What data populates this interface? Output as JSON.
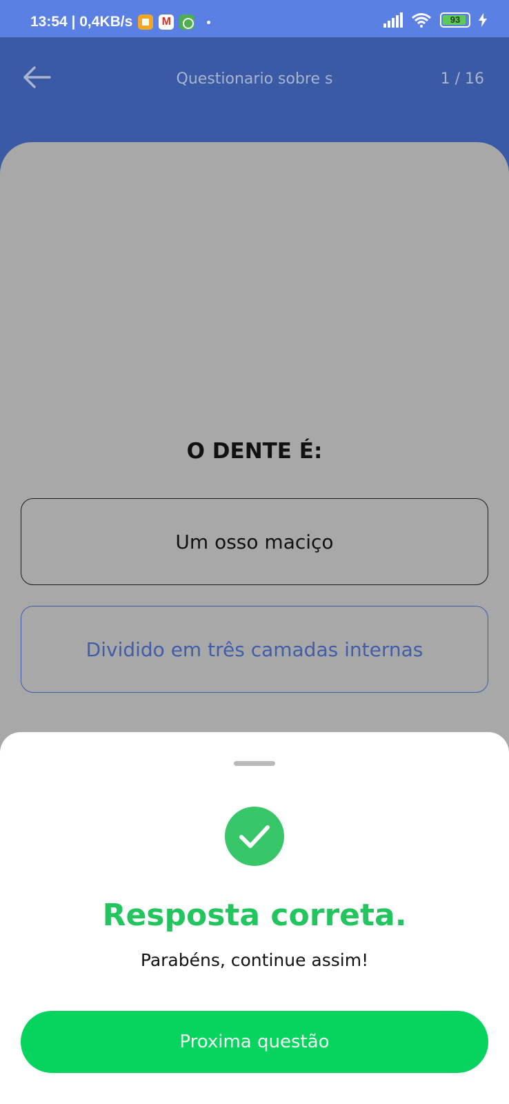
{
  "status_bar": {
    "time_speed": "13:54 | 0,4KB/s",
    "battery": "93",
    "battery_level_percent": 93,
    "icons": [
      "orange-app-icon",
      "gmail-icon",
      "green-app-icon",
      "notification-dot",
      "signal-icon",
      "wifi-icon",
      "battery-icon",
      "charging-icon"
    ]
  },
  "header": {
    "title": "Questionario sobre s",
    "counter": "1 / 16",
    "back_icon": "arrow-left-icon"
  },
  "question": {
    "text": "O DENTE É:",
    "options": [
      {
        "label": "Um osso maciço"
      },
      {
        "label": "Dividido em três camadas internas"
      }
    ]
  },
  "result_sheet": {
    "icon": "check-icon",
    "title": "Resposta correta.",
    "subtitle": "Parabéns, continue assim!",
    "next_button_label": "Proxima questão"
  },
  "colors": {
    "status_bar": "#5a80e4",
    "app_bar": "#3a5aa6",
    "success_green": "#22c55e",
    "button_green": "#06d45e",
    "option_blue": "#3f5da9"
  }
}
